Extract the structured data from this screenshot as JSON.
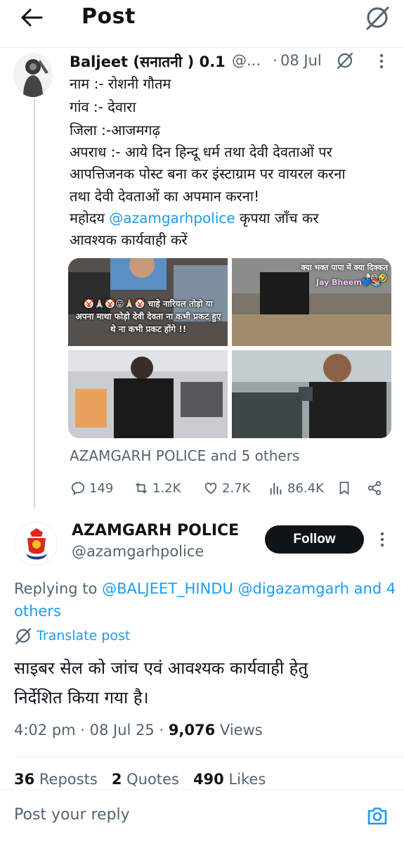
{
  "header": {
    "title": "Post",
    "back_icon": "arrow-left-icon",
    "grok_icon": "grok-icon"
  },
  "quoted": {
    "author_name": "Baljeet (सनातनी ) 0.1",
    "author_handle": "@...",
    "separator": "·",
    "date": "08 Jul",
    "lines": [
      "नाम :- रोशनी गौतम",
      "गांव :- देवारा",
      "जिला :-आजमगढ़",
      "अपराध :- आये दिन हिन्दू धर्म तथा देवी देवताओं पर",
      "आपत्तिजनक पोस्ट बना कर इंस्टाग्राम पर वायरल करना",
      "तथा देवी देवताओं का अपमान करना!"
    ],
    "line_mention_prefix": "महोदय ",
    "line_mention": "@azamgarhpolice",
    "line_mention_suffix": " कृपया जाँच कर",
    "line_last": "आवश्यक कार्यवाही करें",
    "media_captions": {
      "m1": "🤡🙏🏻🤡😛🙏🏻🤡 चाहे नारियल तोड़ो या अपना माथा फोड़ो देवी देवता ना कभी प्रकट हुए थे ना कभी प्रकट होंगे !!",
      "m2": "क्या भक्त पापा में क्या दिक्कत है😅🤣",
      "m2b": "Jay Bheem💙📚"
    },
    "tagged": "AZAMGARH POLICE and 5 others",
    "actions": {
      "replies": "149",
      "reposts": "1.2K",
      "likes": "2.7K",
      "views": "86.4K"
    }
  },
  "main": {
    "author_name": "AZAMGARH POLICE",
    "author_handle": "@azamgarhpolice",
    "follow_label": "Follow",
    "replying_prefix": "Replying to ",
    "replying_to": "@BALJEET_HINDU @digazamgarh and 4",
    "replying_suffix": "others",
    "translate_label": "Translate post",
    "text_line1": "साइबर सेल को जांच एवं आवश्यक कार्यवाही हेतु",
    "text_line2": "निर्देशित किया गया है।",
    "time": "4:02 pm · 08 Jul 25 · ",
    "views_count": "9,076",
    "views_label": " Views",
    "reposts_count": "36",
    "reposts_label": " Reposts",
    "quotes_count": "2",
    "quotes_label": " Quotes",
    "likes_count": "490",
    "likes_label": " Likes"
  },
  "reply_bar": {
    "placeholder": "Post your reply",
    "camera_icon": "camera-icon"
  },
  "colors": {
    "accent": "#1d9bf0",
    "text": "#0f1419",
    "muted": "#536471",
    "border": "#eff3f4"
  }
}
